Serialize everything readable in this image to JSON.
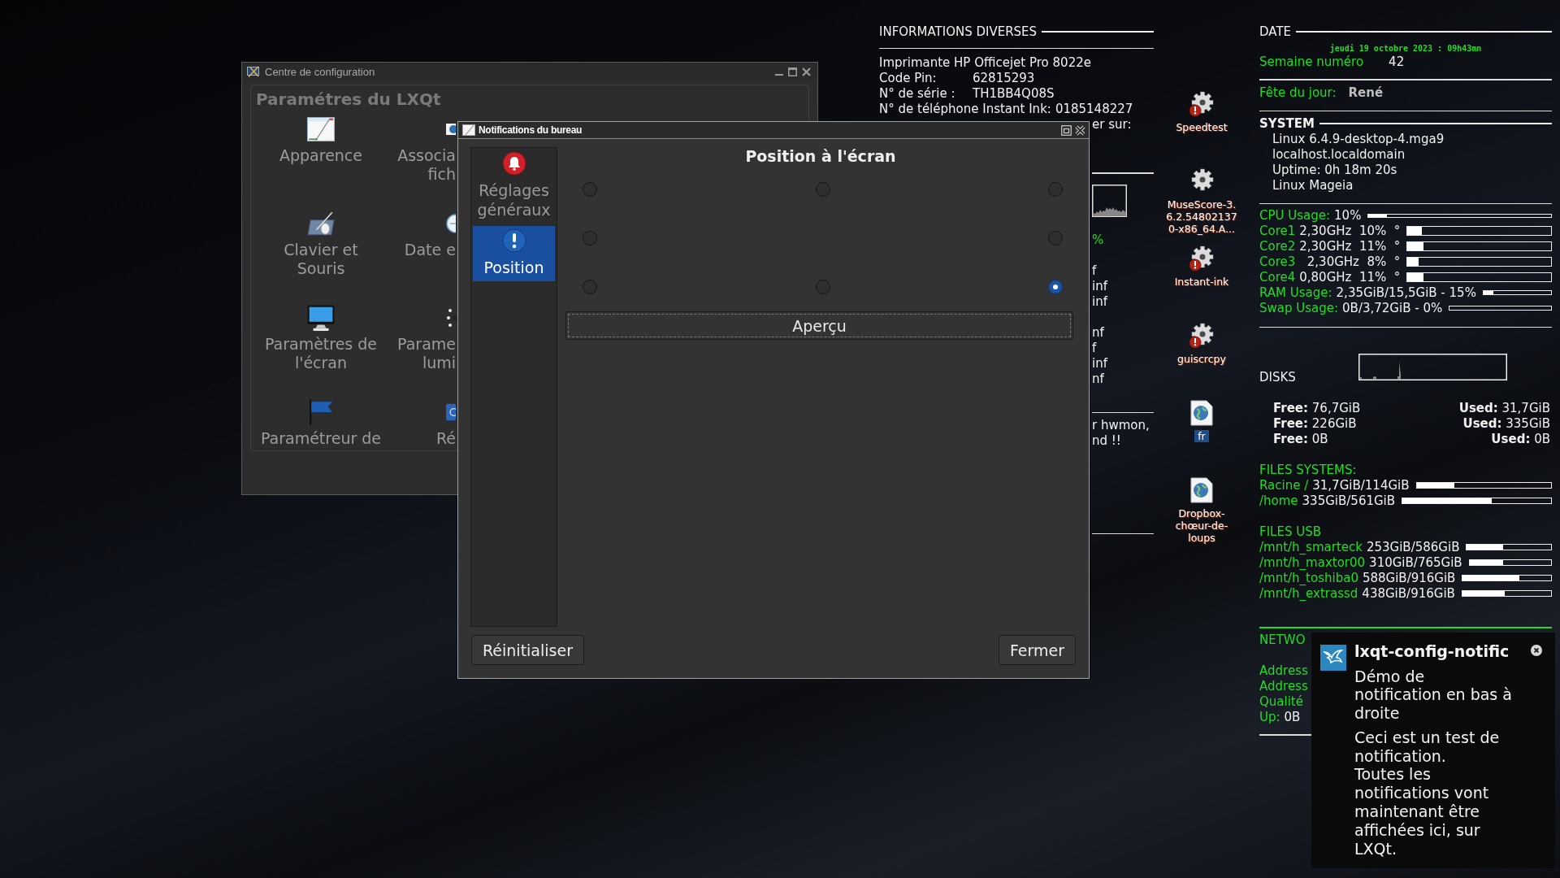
{
  "config_window": {
    "title": "Centre de configuration",
    "group_title": "Paramétres du LXQt",
    "items": [
      {
        "kind": "window",
        "lines": [
          "Apparence"
        ]
      },
      {
        "kind": "globe",
        "lines": [
          "Associa",
          "fich"
        ]
      },
      {
        "kind": "tablet",
        "lines": [
          "Clavier et",
          "Souris"
        ]
      },
      {
        "kind": "clock",
        "lines": [
          "Date e"
        ]
      },
      {
        "kind": "monitor",
        "lines": [
          "Paramètres de",
          "l'écran"
        ]
      },
      {
        "kind": "dots",
        "lines": [
          "Parame",
          "lumi"
        ]
      },
      {
        "kind": "flag",
        "lines": [
          "Paramétreur de"
        ]
      },
      {
        "kind": "tile",
        "lines": [
          "Ré"
        ]
      }
    ]
  },
  "dialog": {
    "title": "Notifications du bureau",
    "nav": [
      {
        "kind": "bell",
        "label": "Réglages généraux",
        "selected": false
      },
      {
        "kind": "info",
        "label": "Position",
        "selected": true
      }
    ],
    "heading": "Position à l'écran",
    "positions": [
      {
        "selected": false
      },
      {
        "selected": false
      },
      {
        "selected": false
      },
      {
        "selected": false
      },
      {
        "selected": false
      },
      {
        "selected": false
      },
      {
        "selected": false
      },
      {
        "selected": true
      }
    ],
    "preview_button": "Aperçu",
    "buttons": [
      "Réinitialiser",
      "Fermer"
    ]
  },
  "info_panel": {
    "title": "INFORMATIONS DIVERSES",
    "lines": [
      {
        "label": "Imprimante HP Officejet Pro 8022e"
      },
      {
        "label": "Code Pin:",
        "value": "62815293"
      },
      {
        "label": "N° de série :",
        "value": "TH1BB4Q08S"
      },
      {
        "label": "N° de téléphone Instant Ink:",
        "value": "0185148227"
      }
    ],
    "cut_line": "er sur:",
    "cut_groups": [
      {
        "kind": "usage",
        "lines": [
          "%"
        ]
      },
      {
        "kind": "value",
        "lines": [
          "f",
          "inf",
          "inf"
        ]
      },
      {
        "kind": "value",
        "lines": [
          "nf",
          "f",
          "inf",
          "nf"
        ]
      }
    ],
    "cut_notes": [
      "r hwmon,",
      "nd !!"
    ]
  },
  "desktop_icons": [
    {
      "kind": "gear-warning",
      "lines": [
        "Speedtest"
      ],
      "selected": false
    },
    {
      "kind": "gear",
      "lines": [
        "MuseScore-3.",
        "6.2.54802137",
        "0-x86_64.A..."
      ],
      "selected": false
    },
    {
      "kind": "gear-warning",
      "lines": [
        "Instant-ink"
      ],
      "selected": false
    },
    {
      "kind": "gear-warning",
      "lines": [
        "guiscrcpy"
      ],
      "selected": false
    },
    {
      "kind": "globe-doc",
      "lines": [
        "fr"
      ],
      "selected": true
    },
    {
      "kind": "globe-doc",
      "lines": [
        "Dropbox-",
        "chœur-de-",
        "loups"
      ],
      "selected": false
    }
  ],
  "system_panel": {
    "date": {
      "title": "DATE",
      "datetime": "jeudi 19 octobre 2023 : 09h43mn",
      "week_label": "Semaine numéro",
      "week": "42",
      "feast_label": "Fête du jour:",
      "feast": "René"
    },
    "system": {
      "title": "SYSTEM",
      "lines": [
        "Linux 6.4.9-desktop-4.mga9",
        "localhost.localdomain",
        "Uptime: 0h 18m 20s",
        "Linux Mageia"
      ]
    },
    "usage": [
      {
        "kind": "thin",
        "label": "CPU Usage:",
        "value": "10%",
        "level": 0.1
      },
      {
        "kind": "core",
        "label": "Core1",
        "value": "2,30GHz  10%  °",
        "level": 0.1
      },
      {
        "kind": "core",
        "label": "Core2",
        "value": "2,30GHz  11%  °",
        "level": 0.11
      },
      {
        "kind": "core",
        "label": "Core3",
        "value": "  2,30GHz  8%  °",
        "level": 0.08
      },
      {
        "kind": "core",
        "label": "Core4",
        "value": "0,80GHz  11%  °",
        "level": 0.11
      },
      {
        "kind": "slim",
        "label": "RAM Usage:",
        "value": "2,35GiB/15,5GiB - 15%",
        "level": 0.15
      },
      {
        "kind": "slim",
        "label": "Swap Usage:",
        "value": "0B/3,72GiB - 0%",
        "level": 0
      }
    ],
    "disks": {
      "title": "DISKS",
      "rows": [
        {
          "free": "**Free:** 76,7GiB",
          "used": "**Used:** 31,7GiB"
        },
        {
          "free": "**Free:** 226GiB",
          "used": "**Used:** 335GiB"
        },
        {
          "free": "**Free:** 0B",
          "used": "**Used:** 0B"
        }
      ]
    },
    "filesystems": {
      "title": "FILES SYSTEMS:",
      "items": [
        {
          "label": "Racine /",
          "value": "31,7GiB/114GiB",
          "level": 0.28
        },
        {
          "label": "/home",
          "value": "335GiB/561GiB",
          "level": 0.6
        }
      ]
    },
    "usb": {
      "title": "FILES USB",
      "items": [
        {
          "label": "/mnt/h_smarteck",
          "value": "253GiB/586GiB",
          "level": 0.43
        },
        {
          "label": "/mnt/h_maxtor00",
          "value": "310GiB/765GiB",
          "level": 0.41
        },
        {
          "label": "/mnt/h_toshiba0",
          "value": "588GiB/916GiB",
          "level": 0.64
        },
        {
          "label": "/mnt/h_extrassd",
          "value": "438GiB/916GiB",
          "level": 0.48
        }
      ]
    },
    "network": {
      "title": "NETWO",
      "lines": [
        {
          "label": "Address"
        },
        {
          "label": "Address"
        },
        {
          "label": "Qualité"
        },
        {
          "label": "Up:",
          "value": "0B"
        }
      ]
    }
  },
  "notification": {
    "app": "lxqt-config-notific",
    "summary": "Démo de notification en bas à droite",
    "body": [
      "Ceci est un test de notification.",
      "Toutes les notifications vont maintenant être affichées ici, sur LXQt."
    ]
  }
}
